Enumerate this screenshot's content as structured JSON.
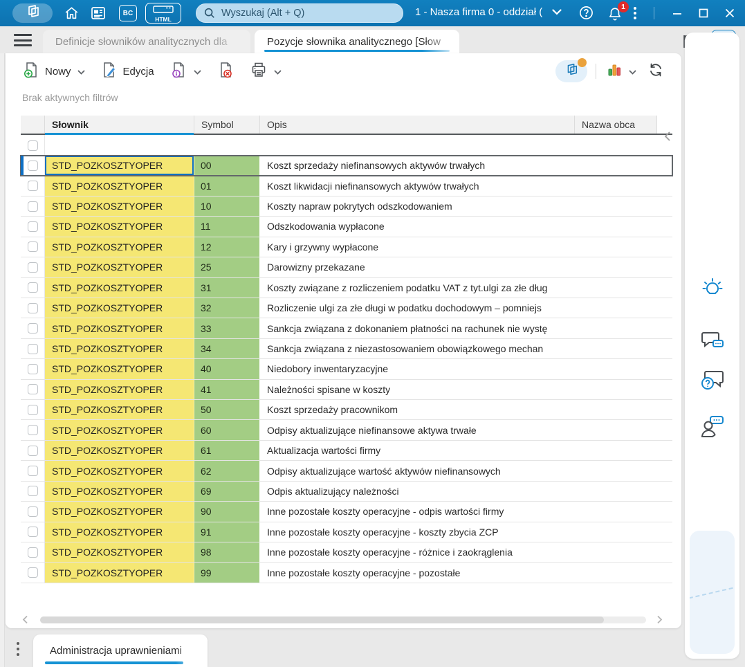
{
  "titlebar": {
    "search_placeholder": "Wyszukaj (Alt + Q)",
    "company_label": "1 - Nasza firma 0 - oddział (",
    "notification_count": "1",
    "bc_icon_label": "BC",
    "html_icon_label": "HTML"
  },
  "tab_bar": {
    "tabs": [
      {
        "label": "Definicje słowników analitycznych dla",
        "active": false
      },
      {
        "label": "Pozycje słownika analitycznego [Słow",
        "active": true
      }
    ]
  },
  "toolbar": {
    "new_label": "Nowy",
    "edit_label": "Edycja"
  },
  "filters": {
    "status_text": "Brak aktywnych filtrów"
  },
  "table": {
    "columns": {
      "slownik": "Słownik",
      "symbol": "Symbol",
      "opis": "Opis",
      "nazwa_obca": "Nazwa obca"
    },
    "sorted_column": "slownik",
    "rows": [
      {
        "slownik": "STD_POZKOSZTYOPER",
        "symbol": "00",
        "opis": "Koszt sprzedaży niefinansowych aktywów trwałych",
        "nazwa_obca": "",
        "selected": true
      },
      {
        "slownik": "STD_POZKOSZTYOPER",
        "symbol": "01",
        "opis": "Koszt likwidacji niefinansowych aktywów trwałych",
        "nazwa_obca": "",
        "selected": false
      },
      {
        "slownik": "STD_POZKOSZTYOPER",
        "symbol": "10",
        "opis": "Koszty napraw pokrytych odszkodowaniem",
        "nazwa_obca": "",
        "selected": false
      },
      {
        "slownik": "STD_POZKOSZTYOPER",
        "symbol": "11",
        "opis": "Odszkodowania wypłacone",
        "nazwa_obca": "",
        "selected": false
      },
      {
        "slownik": "STD_POZKOSZTYOPER",
        "symbol": "12",
        "opis": "Kary i grzywny wypłacone",
        "nazwa_obca": "",
        "selected": false
      },
      {
        "slownik": "STD_POZKOSZTYOPER",
        "symbol": "25",
        "opis": "Darowizny przekazane",
        "nazwa_obca": "",
        "selected": false
      },
      {
        "slownik": "STD_POZKOSZTYOPER",
        "symbol": "31",
        "opis": "Koszty związane z rozliczeniem podatku VAT z tyt.ulgi za złe dług",
        "nazwa_obca": "",
        "selected": false
      },
      {
        "slownik": "STD_POZKOSZTYOPER",
        "symbol": "32",
        "opis": "Rozliczenie ulgi za złe długi w podatku dochodowym – pomniejs",
        "nazwa_obca": "",
        "selected": false
      },
      {
        "slownik": "STD_POZKOSZTYOPER",
        "symbol": "33",
        "opis": "Sankcja związana z dokonaniem płatności na rachunek nie wystę",
        "nazwa_obca": "",
        "selected": false
      },
      {
        "slownik": "STD_POZKOSZTYOPER",
        "symbol": "34",
        "opis": "Sankcja związana z niezastosowaniem obowiązkowego mechan",
        "nazwa_obca": "",
        "selected": false
      },
      {
        "slownik": "STD_POZKOSZTYOPER",
        "symbol": "40",
        "opis": "Niedobory inwentaryzacyjne",
        "nazwa_obca": "",
        "selected": false
      },
      {
        "slownik": "STD_POZKOSZTYOPER",
        "symbol": "41",
        "opis": "Należności spisane w koszty",
        "nazwa_obca": "",
        "selected": false
      },
      {
        "slownik": "STD_POZKOSZTYOPER",
        "symbol": "50",
        "opis": "Koszt sprzedaży pracownikom",
        "nazwa_obca": "",
        "selected": false
      },
      {
        "slownik": "STD_POZKOSZTYOPER",
        "symbol": "60",
        "opis": "Odpisy aktualizujące niefinansowe aktywa trwałe",
        "nazwa_obca": "",
        "selected": false
      },
      {
        "slownik": "STD_POZKOSZTYOPER",
        "symbol": "61",
        "opis": "Aktualizacja wartości firmy",
        "nazwa_obca": "",
        "selected": false
      },
      {
        "slownik": "STD_POZKOSZTYOPER",
        "symbol": "62",
        "opis": "Odpisy aktualizujące wartość aktywów niefinansowych",
        "nazwa_obca": "",
        "selected": false
      },
      {
        "slownik": "STD_POZKOSZTYOPER",
        "symbol": "69",
        "opis": "Odpis aktualizujący należności",
        "nazwa_obca": "",
        "selected": false
      },
      {
        "slownik": "STD_POZKOSZTYOPER",
        "symbol": "90",
        "opis": "Inne pozostałe koszty operacyjne - odpis wartości firmy",
        "nazwa_obca": "",
        "selected": false
      },
      {
        "slownik": "STD_POZKOSZTYOPER",
        "symbol": "91",
        "opis": "Inne pozostałe koszty operacyjne - koszty zbycia ZCP",
        "nazwa_obca": "",
        "selected": false
      },
      {
        "slownik": "STD_POZKOSZTYOPER",
        "symbol": "98",
        "opis": "Inne pozostałe koszty operacyjne  - różnice i zaokrąglenia",
        "nazwa_obca": "",
        "selected": false
      },
      {
        "slownik": "STD_POZKOSZTYOPER",
        "symbol": "99",
        "opis": "Inne pozostałe koszty operacyjne - pozostałe",
        "nazwa_obca": "",
        "selected": false
      }
    ]
  },
  "bottom_bar": {
    "tab_label": "Administracja uprawnieniami"
  },
  "colors": {
    "titlebar": "#0e77b6",
    "accent": "#1793d4",
    "slownik_cell_bg": "#f5e773",
    "symbol_cell_bg": "#a3cd84",
    "notification_badge": "#e02b2b",
    "selected_row_border": "#63676b",
    "focus_cell_border": "#0d6fc4"
  },
  "sidebar_icons": [
    "lightbulb",
    "chat-feedback",
    "help-question",
    "consultant-chat"
  ]
}
